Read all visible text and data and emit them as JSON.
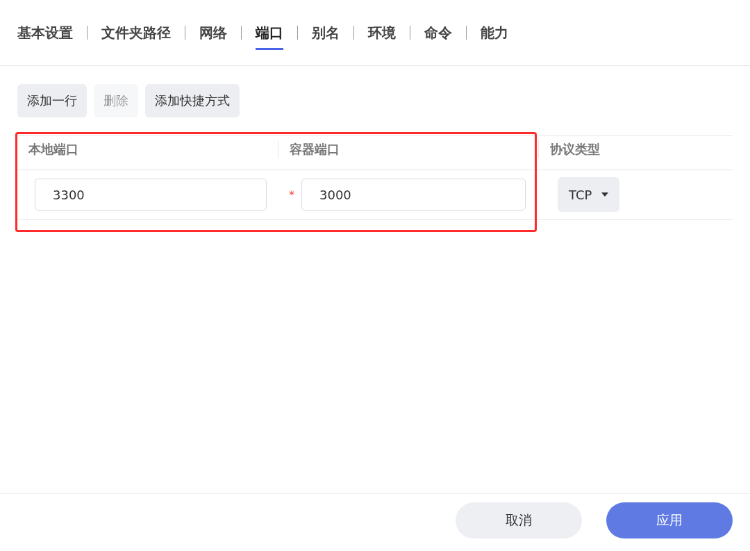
{
  "tabs": [
    {
      "label": "基本设置",
      "selected": false
    },
    {
      "label": "文件夹路径",
      "selected": false
    },
    {
      "label": "网络",
      "selected": false
    },
    {
      "label": "端口",
      "selected": true
    },
    {
      "label": "别名",
      "selected": false
    },
    {
      "label": "环境",
      "selected": false
    },
    {
      "label": "命令",
      "selected": false
    },
    {
      "label": "能力",
      "selected": false
    }
  ],
  "toolbar": [
    {
      "label": "添加一行",
      "disabled": false
    },
    {
      "label": "删除",
      "disabled": true
    },
    {
      "label": "添加快捷方式",
      "disabled": false
    }
  ],
  "table": {
    "columns": [
      "本地端口",
      "容器端口",
      "协议类型"
    ],
    "rows": [
      {
        "local_port": "3300",
        "container_port": "3000",
        "required_mark": "*",
        "protocol": "TCP",
        "highlighted": true
      }
    ]
  },
  "footer": [
    {
      "label": "取消",
      "kind": "secondary"
    },
    {
      "label": "应用",
      "kind": "primary"
    }
  ]
}
